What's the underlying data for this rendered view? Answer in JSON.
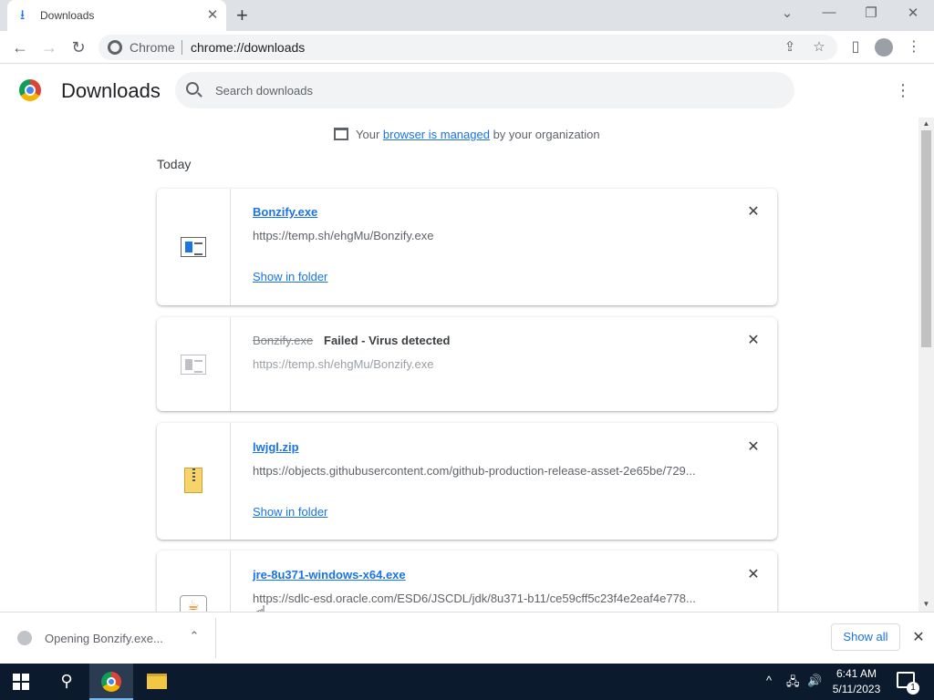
{
  "tab": {
    "title": "Downloads",
    "close": "✕",
    "new_tab": "+"
  },
  "window": {
    "dropdown": "⌄",
    "minimize": "—",
    "restore": "❐",
    "close": "✕"
  },
  "toolbar": {
    "back": "←",
    "forward": "→",
    "reload": "↻",
    "site_label": "Chrome",
    "url": "chrome://downloads",
    "share": "⇪",
    "bookmark": "☆",
    "side_panel": "▯",
    "menu": "⋮"
  },
  "downloads_page": {
    "title": "Downloads",
    "search_placeholder": "Search downloads",
    "menu": "⋮",
    "managed": {
      "prefix": "Your ",
      "link": "browser is managed",
      "suffix": " by your organization"
    },
    "section": "Today",
    "items": [
      {
        "name": "Bonzify.exe",
        "url": "https://temp.sh/ehgMu/Bonzify.exe",
        "show_in_folder": "Show in folder",
        "remove": "✕",
        "icon": "exe-file-icon",
        "status": "complete"
      },
      {
        "name": "Bonzify.exe",
        "status_text": "Failed - Virus detected",
        "url": "https://temp.sh/ehgMu/Bonzify.exe",
        "remove": "✕",
        "icon": "exe-file-icon",
        "status": "failed"
      },
      {
        "name": "lwjgl.zip",
        "url": "https://objects.githubusercontent.com/github-production-release-asset-2e65be/729...",
        "show_in_folder": "Show in folder",
        "remove": "✕",
        "icon": "zip-file-icon",
        "status": "complete"
      },
      {
        "name": "jre-8u371-windows-x64.exe",
        "url": "https://sdlc-esd.oracle.com/ESD6/JSCDL/jdk/8u371-b11/ce59cff5c23f4e2eaf4e778...",
        "remove": "✕",
        "icon": "java-file-icon",
        "status": "complete"
      }
    ]
  },
  "shelf": {
    "item_label": "Opening Bonzify.exe...",
    "chevron": "⌃",
    "show_all": "Show all",
    "close": "✕"
  },
  "taskbar": {
    "search": "⚲",
    "tray_chevron": "^",
    "network": "🖧",
    "volume": "🔊",
    "time": "6:41 AM",
    "date": "5/11/2023",
    "notification_count": "1"
  },
  "colors": {
    "accent": "#1a73e8",
    "taskbar": "#0c1a2e"
  }
}
